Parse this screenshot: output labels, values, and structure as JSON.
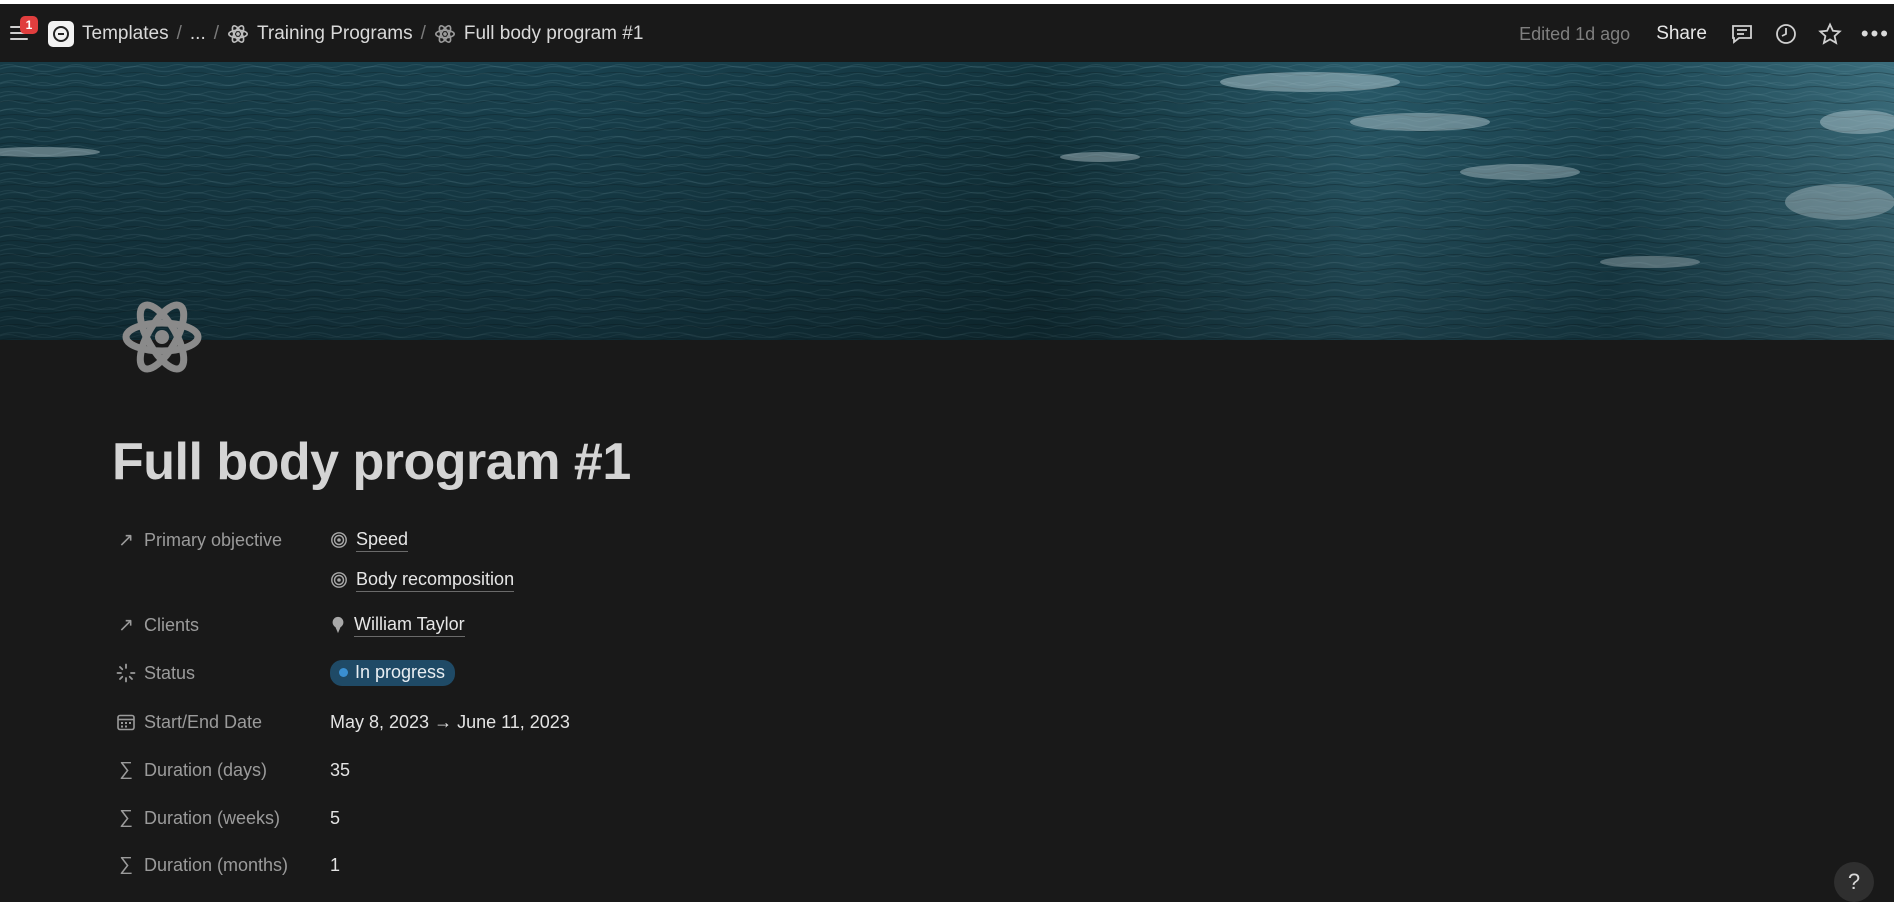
{
  "notifications": {
    "count": "1"
  },
  "breadcrumb": {
    "items": [
      {
        "label": "Templates",
        "icon": "workspace-logo"
      },
      {
        "label": "...",
        "icon": ""
      },
      {
        "label": "Training Programs",
        "icon": "atom-icon"
      },
      {
        "label": "Full body program #1",
        "icon": "atom-icon"
      }
    ],
    "separator": "/"
  },
  "toolbar": {
    "edited": "Edited 1d ago",
    "share_label": "Share",
    "icons": [
      "comment-icon",
      "clock-icon",
      "star-icon",
      "more-icon"
    ],
    "more_label": "•••"
  },
  "cover": {
    "description_colors": {
      "deep": "#0f2f38",
      "mid": "#1e4f5e",
      "light": "#5a8e9c"
    }
  },
  "page": {
    "icon": "atom-icon",
    "title": "Full body program #1"
  },
  "properties": [
    {
      "label": "Primary objective",
      "icon": "relation-arrow-icon",
      "type": "relation",
      "values": [
        "Speed",
        "Body recomposition"
      ],
      "value_icon": "target-icon"
    },
    {
      "label": "Clients",
      "icon": "relation-arrow-icon",
      "type": "relation",
      "values": [
        "William Taylor"
      ],
      "value_icon": "person-icon"
    },
    {
      "label": "Status",
      "icon": "status-icon",
      "type": "status",
      "value": "In progress",
      "color": "#1f4a66",
      "dot_color": "#3a8fd1"
    },
    {
      "label": "Start/End Date",
      "icon": "calendar-icon",
      "type": "date",
      "value": "May 8, 2023 → June 11, 2023"
    },
    {
      "label": "Duration (days)",
      "icon": "sigma-icon",
      "type": "formula",
      "value": "35"
    },
    {
      "label": "Duration (weeks)",
      "icon": "sigma-icon",
      "type": "formula",
      "value": "5"
    },
    {
      "label": "Duration (months)",
      "icon": "sigma-icon",
      "type": "formula",
      "value": "1"
    }
  ],
  "help": {
    "label": "?"
  },
  "glyphs": {
    "relation_arrow": "↗",
    "sigma": "∑"
  }
}
